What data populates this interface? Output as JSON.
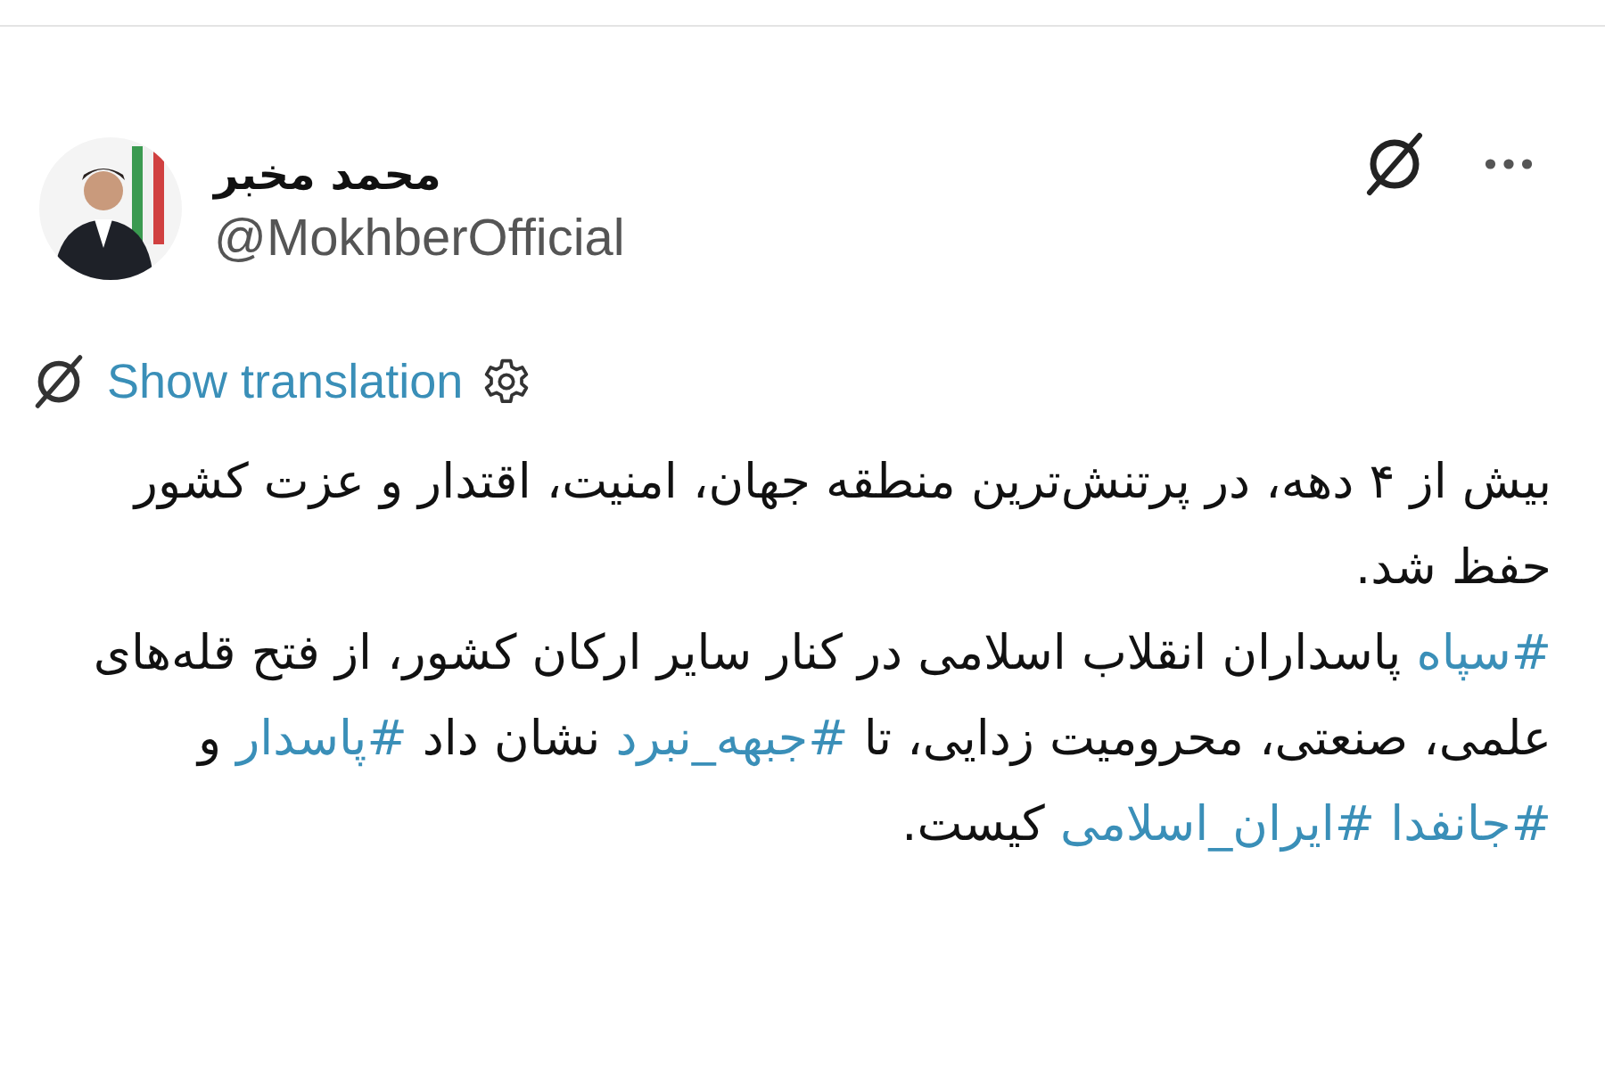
{
  "author": {
    "name": "محمد مخبر",
    "handle": "@MokhberOfficial"
  },
  "translation": {
    "label": "Show translation"
  },
  "body": [
    {
      "segments": [
        {
          "kind": "plain",
          "text": "بیش از ۴ دهه، در پرتنش‌ترین منطقه جهان، امنیت، اقتدار و عزت کشور حفظ شد."
        }
      ]
    },
    {
      "segments": [
        {
          "kind": "hashtag",
          "text": "#سپاه"
        },
        {
          "kind": "plain",
          "text": " پاسداران انقلاب اسلامی در کنار سایر ارکان کشور، از فتح قله‌های علمی، صنعتی، محرومیت زدایی، تا "
        },
        {
          "kind": "hashtag",
          "text": "#جبهه_نبرد"
        },
        {
          "kind": "plain",
          "text": " نشان داد "
        },
        {
          "kind": "hashtag",
          "text": "#پاسدار"
        },
        {
          "kind": "plain",
          "text": " و "
        },
        {
          "kind": "hashtag",
          "text": "#جانفدا "
        },
        {
          "kind": "hashtag",
          "text": "#ایران_اسلامی"
        },
        {
          "kind": "plain",
          "text": " کیست."
        }
      ]
    }
  ]
}
